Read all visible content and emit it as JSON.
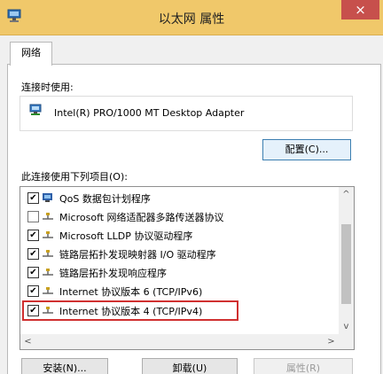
{
  "window": {
    "title": "以太网 属性",
    "close_glyph": "×",
    "titlebar_color": "#f0c86a"
  },
  "tabs": [
    {
      "label": "网络",
      "active": true
    }
  ],
  "connect_using": {
    "label": "连接时使用:",
    "adapter": "Intel(R) PRO/1000 MT Desktop Adapter"
  },
  "buttons": {
    "configure": "配置(C)...",
    "install": "安装(N)...",
    "uninstall": "卸载(U)",
    "properties": "属性(R)"
  },
  "items_label": "此连接使用下列项目(O):",
  "items": [
    {
      "checked": true,
      "icon": "qos-icon",
      "label": "QoS 数据包计划程序"
    },
    {
      "checked": false,
      "icon": "protocol-icon",
      "label": "Microsoft 网络适配器多路传送器协议"
    },
    {
      "checked": true,
      "icon": "protocol-icon",
      "label": "Microsoft LLDP 协议驱动程序"
    },
    {
      "checked": true,
      "icon": "protocol-icon",
      "label": "链路层拓扑发现映射器 I/O 驱动程序"
    },
    {
      "checked": true,
      "icon": "protocol-icon",
      "label": "链路层拓扑发现响应程序"
    },
    {
      "checked": true,
      "icon": "protocol-icon",
      "label": "Internet 协议版本 6 (TCP/IPv6)"
    },
    {
      "checked": true,
      "icon": "protocol-icon",
      "label": "Internet 协议版本 4 (TCP/IPv4)",
      "highlighted": true
    }
  ],
  "scroll_glyphs": {
    "up": "^",
    "down": "v",
    "left": "<",
    "right": ">"
  },
  "checkbox_glyph": "✔",
  "highlight_color": "#d03030"
}
